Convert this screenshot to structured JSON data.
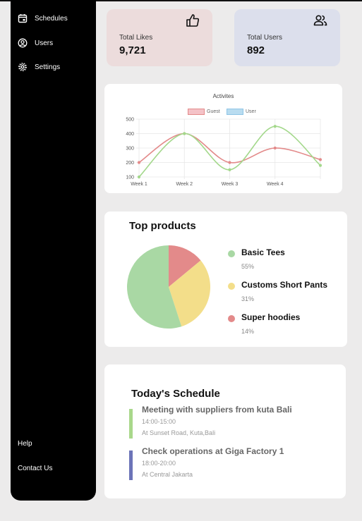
{
  "sidebar": {
    "nav": [
      {
        "label": "Schedules",
        "icon": "calendar-icon"
      },
      {
        "label": "Users",
        "icon": "user-circle-icon"
      },
      {
        "label": "Settings",
        "icon": "gear-icon"
      }
    ],
    "help": "Help",
    "contact": "Contact Us"
  },
  "stats": {
    "likes": {
      "label": "Total Likes",
      "value": "9,721",
      "icon": "thumbs-up-icon",
      "bg": "#ecdcdc"
    },
    "users": {
      "label": "Total Users",
      "value": "892",
      "icon": "users-icon",
      "bg": "#dcdfec"
    }
  },
  "activities": {
    "chart_data": {
      "type": "line",
      "title": "Activites",
      "x": [
        "Week 1",
        "Week 2",
        "Week 3",
        "Week 4",
        ""
      ],
      "series": [
        {
          "name": "Guest",
          "color": "#e38a8a",
          "values": [
            200,
            400,
            200,
            300,
            220
          ]
        },
        {
          "name": "User",
          "color": "#a3d88b",
          "values": [
            100,
            400,
            150,
            450,
            180
          ]
        }
      ],
      "ylim": [
        100,
        500
      ],
      "yticks": [
        "500",
        "400",
        "300",
        "200",
        "100"
      ],
      "grid": true,
      "legend": "top"
    }
  },
  "top_products": {
    "title": "Top products",
    "chart_data": {
      "type": "pie",
      "categories": [
        "Basic Tees",
        "Customs Short Pants",
        "Super hoodies"
      ],
      "values": [
        55,
        31,
        14
      ],
      "colors": [
        "#a9d8a4",
        "#f3de8a",
        "#e38a8a"
      ]
    },
    "items": [
      {
        "name": "Basic Tees",
        "pct": "55%",
        "color": "#a9d8a4"
      },
      {
        "name": "Customs Short Pants",
        "pct": "31%",
        "color": "#f3de8a"
      },
      {
        "name": "Super hoodies",
        "pct": "14%",
        "color": "#e38a8a"
      }
    ]
  },
  "schedule": {
    "title": "Today's Schedule",
    "events": [
      {
        "title": "Meeting with suppliers from kuta Bali",
        "time": "14:00-15:00",
        "place": "At Sunset Road, Kuta,Bali",
        "color": "#a9d88b"
      },
      {
        "title": "Check operations at Giga Factory 1",
        "time": "18:00-20:00",
        "place": "At Central Jakarta",
        "color": "#6c74b8"
      }
    ]
  }
}
